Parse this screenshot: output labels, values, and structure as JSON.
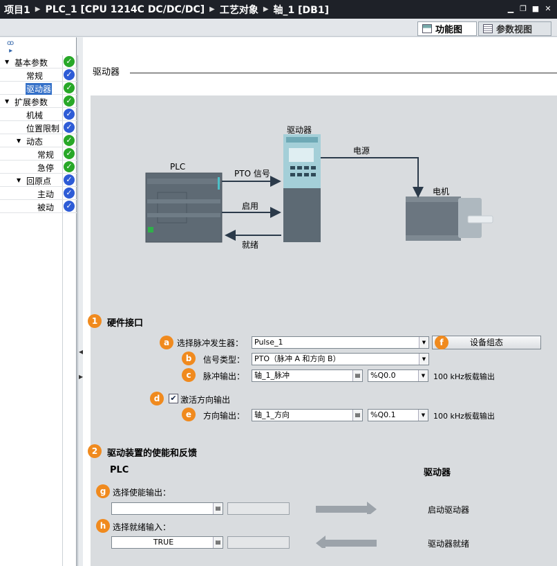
{
  "titlebar": {
    "crumbs": [
      "项目1",
      "PLC_1 [CPU 1214C DC/DC/DC]",
      "工艺对象",
      "轴_1 [DB1]"
    ],
    "win_buttons": [
      "minimize",
      "restore",
      "maximize",
      "close"
    ]
  },
  "view_tabs": {
    "function_view": "功能图",
    "param_view": "参数视图"
  },
  "tree": {
    "items": [
      {
        "label": "基本参数",
        "status": "green",
        "expandable": true
      },
      {
        "label": "常规",
        "status": "blue"
      },
      {
        "label": "驱动器",
        "status": "green",
        "selected": true
      },
      {
        "label": "扩展参数",
        "status": "green",
        "expandable": true
      },
      {
        "label": "机械",
        "status": "blue"
      },
      {
        "label": "位置限制",
        "status": "blue"
      },
      {
        "label": "动态",
        "status": "green",
        "expandable": true
      },
      {
        "label": "常规",
        "status": "green"
      },
      {
        "label": "急停",
        "status": "green"
      },
      {
        "label": "回原点",
        "status": "blue",
        "expandable": true
      },
      {
        "label": "主动",
        "status": "blue"
      },
      {
        "label": "被动",
        "status": "blue"
      }
    ]
  },
  "section_title": "驱动器",
  "diagram": {
    "plc_label": "PLC",
    "drive_label": "驱动器",
    "motor_label": "电机",
    "power_label": "电源",
    "pto_label": "PTO 信号",
    "enable_label": "启用",
    "ready_label": "就绪"
  },
  "hw_interface": {
    "number": "1",
    "title": "硬件接口",
    "pulse_gen": {
      "badge": "a",
      "label": "选择脉冲发生器：",
      "value": "Pulse_1"
    },
    "device_config": {
      "badge": "f",
      "label": "设备组态"
    },
    "signal_type": {
      "badge": "b",
      "label": "信号类型：",
      "value": "PTO（脉冲 A 和方向 B）"
    },
    "pulse_output": {
      "badge": "c",
      "label": "脉冲输出：",
      "tag": "轴_1_脉冲",
      "address": "%Q0.0",
      "note": "100 kHz板载输出"
    },
    "dir_enable": {
      "badge": "d",
      "label": "激活方向输出",
      "checked": true
    },
    "dir_output": {
      "badge": "e",
      "label": "方向输出：",
      "tag": "轴_1_方向",
      "address": "%Q0.1",
      "note": "100 kHz板载输出"
    }
  },
  "drive_enable": {
    "number": "2",
    "title": "驱动装置的使能和反馈",
    "plc_col": "PLC",
    "drive_col": "驱动器",
    "enable_output": {
      "badge": "g",
      "label": "选择使能输出：",
      "value": "",
      "target": "启动驱动器"
    },
    "ready_input": {
      "badge": "h",
      "label": "选择就绪输入：",
      "value": "TRUE",
      "target": "驱动器就绪"
    }
  },
  "colors": {
    "accent": "#f08a1e",
    "ok_green": "#28a828",
    "ok_blue": "#2e5cd6",
    "titlebar": "#1e2128"
  }
}
